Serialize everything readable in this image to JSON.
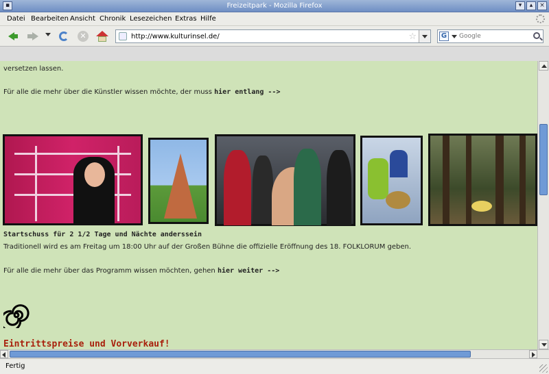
{
  "window": {
    "title": "Freizeitpark - Mozilla Firefox"
  },
  "menu": {
    "items": [
      {
        "label": "Datei"
      },
      {
        "label": "Bearbeiten"
      },
      {
        "label": "Ansicht"
      },
      {
        "label": "Chronik"
      },
      {
        "label": "Lesezeichen"
      },
      {
        "label": "Extras"
      },
      {
        "label": "Hilfe"
      }
    ]
  },
  "navigation": {
    "url": "http://www.kulturinsel.de/",
    "search_placeholder": "Google",
    "search_engine_letter": "G"
  },
  "content": {
    "text_top": "versetzen lassen.",
    "artists_prefix": "Für alle die mehr über die Künstler wissen möchte, der muss ",
    "artists_link": "hier entlang -->",
    "heading_start": "Startschuss für 2 1/2 Tage und Nächte anderssein",
    "tradition_text": "Traditionell wird es am Freitag um 18:00 Uhr auf der Großen Bühne die offizielle Eröffnung des 18. FOLKLORUM geben.",
    "program_prefix": "Für alle die mehr über das Programm wissen möchten, gehen ",
    "program_link": "hier weiter -->",
    "heading_prices": "Eintrittspreise und Vorverkauf!"
  },
  "status": {
    "text": "Fertig"
  },
  "colors": {
    "page_background": "#cfe3b8",
    "heading_red": "#a8200c",
    "scroll_thumb": "#6f9ad6"
  }
}
